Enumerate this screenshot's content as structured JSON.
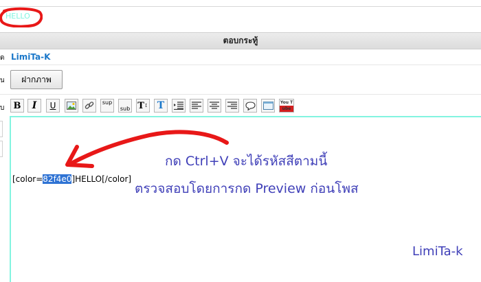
{
  "preview": {
    "text": "HELLO",
    "color": "#82f4e0"
  },
  "reply_header": {
    "title": "ตอบกระทู้"
  },
  "form": {
    "row_labels": [
      "ด",
      "น",
      "บ"
    ],
    "username": "LimiTa-K",
    "upload_button": "ฝากภาพ"
  },
  "toolbar": {
    "buttons": [
      {
        "name": "bold-button",
        "label": "B",
        "icon": "bold-icon"
      },
      {
        "name": "italic-button",
        "label": "I",
        "icon": "italic-icon"
      },
      {
        "name": "underline-button",
        "label": "U",
        "icon": "underline-icon"
      },
      {
        "name": "image-button",
        "label": "",
        "icon": "image-icon"
      },
      {
        "name": "link-button",
        "label": "",
        "icon": "link-icon"
      },
      {
        "name": "superscript-button",
        "label": "sup",
        "icon": "superscript-icon"
      },
      {
        "name": "subscript-button",
        "label": "sub",
        "icon": "subscript-icon"
      },
      {
        "name": "font-size-button",
        "label": "T",
        "icon": "font-size-icon"
      },
      {
        "name": "text-color-button",
        "label": "T",
        "icon": "text-color-icon"
      },
      {
        "name": "indent-button",
        "label": "",
        "icon": "indent-icon"
      },
      {
        "name": "align-left-button",
        "label": "",
        "icon": "align-left-icon"
      },
      {
        "name": "align-center-button",
        "label": "",
        "icon": "align-center-icon"
      },
      {
        "name": "align-right-button",
        "label": "",
        "icon": "align-right-icon"
      },
      {
        "name": "quote-button",
        "label": "",
        "icon": "speech-bubble-icon"
      },
      {
        "name": "code-box-button",
        "label": "",
        "icon": "box-icon"
      },
      {
        "name": "youtube-button",
        "label": "You Tube",
        "icon": "youtube-icon"
      }
    ],
    "accent_color": "#1a77c9"
  },
  "editor": {
    "border_color": "#82f4e0",
    "text_before": "[color=",
    "text_selected": "82f4e0",
    "text_after": "]HELLO[/color]"
  },
  "annotations": {
    "line1": "กด Ctrl+V จะได้รหัสสีตามนี้",
    "line2": "ตรวจสอบโดยการกด Preview ก่อนโพส",
    "signature": "LimiTa-k",
    "ink_color": "#3f3fb8",
    "marker_color": "#e81818"
  }
}
